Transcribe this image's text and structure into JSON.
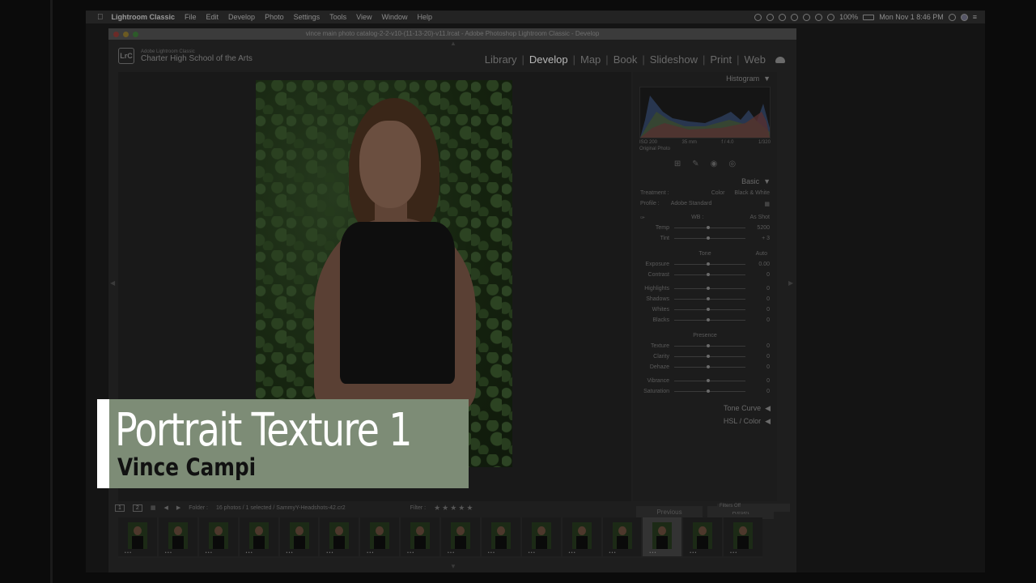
{
  "menubar": {
    "app": "Lightroom Classic",
    "items": [
      "File",
      "Edit",
      "Develop",
      "Photo",
      "Settings",
      "Tools",
      "View",
      "Window",
      "Help"
    ],
    "battery": "100%",
    "clock": "Mon Nov 1  8:46 PM"
  },
  "window": {
    "title": "vince main photo catalog-2-2-v10-(11-13-20)-v11.lrcat - Adobe Photoshop Lightroom Classic - Develop"
  },
  "identity": {
    "logo": "LrC",
    "app_name": "Adobe Lightroom Classic",
    "plate": "Charter High School of the Arts"
  },
  "modules": {
    "items": [
      "Library",
      "Develop",
      "Map",
      "Book",
      "Slideshow",
      "Print",
      "Web"
    ],
    "active": "Develop"
  },
  "right_panel": {
    "histogram_label": "Histogram",
    "histo_meta": [
      "ISO 200",
      "35 mm",
      "f / 4.0",
      "1/320"
    ],
    "original_photo": "Original Photo",
    "basic_label": "Basic",
    "treatment_label": "Treatment :",
    "treatment_color": "Color",
    "treatment_bw": "Black & White",
    "profile_label": "Profile :",
    "profile_value": "Adobe Standard",
    "wb_label": "WB :",
    "wb_value": "As Shot",
    "sliders_wb": [
      {
        "label": "Temp",
        "value": "5200"
      },
      {
        "label": "Tint",
        "value": "+ 3"
      }
    ],
    "tone_label": "Tone",
    "auto_label": "Auto",
    "sliders_tone": [
      {
        "label": "Exposure",
        "value": "0.00"
      },
      {
        "label": "Contrast",
        "value": "0"
      },
      {
        "label": "Highlights",
        "value": "0"
      },
      {
        "label": "Shadows",
        "value": "0"
      },
      {
        "label": "Whites",
        "value": "0"
      },
      {
        "label": "Blacks",
        "value": "0"
      }
    ],
    "presence_label": "Presence",
    "sliders_presence": [
      {
        "label": "Texture",
        "value": "0"
      },
      {
        "label": "Clarity",
        "value": "0"
      },
      {
        "label": "Dehaze",
        "value": "0"
      },
      {
        "label": "Vibrance",
        "value": "0"
      },
      {
        "label": "Saturation",
        "value": "0"
      }
    ],
    "tone_curve": "Tone Curve",
    "hsl": "HSL / Color",
    "previous": "Previous",
    "reset": "Reset"
  },
  "filterbar": {
    "page1": "1",
    "page2": "2",
    "folder": "Folder :",
    "count": "16 photos / 1 selected / SammyY-Headshots-42.cr2",
    "filter": "Filter :",
    "stars": "★★★★★",
    "filters_off": "Filters Off"
  },
  "filmstrip": {
    "count": 16,
    "selected_index": 13
  },
  "lower_third": {
    "title": "Portrait Texture 1",
    "subtitle": "Vince Campi",
    "bg_color": "#7d8c76"
  }
}
